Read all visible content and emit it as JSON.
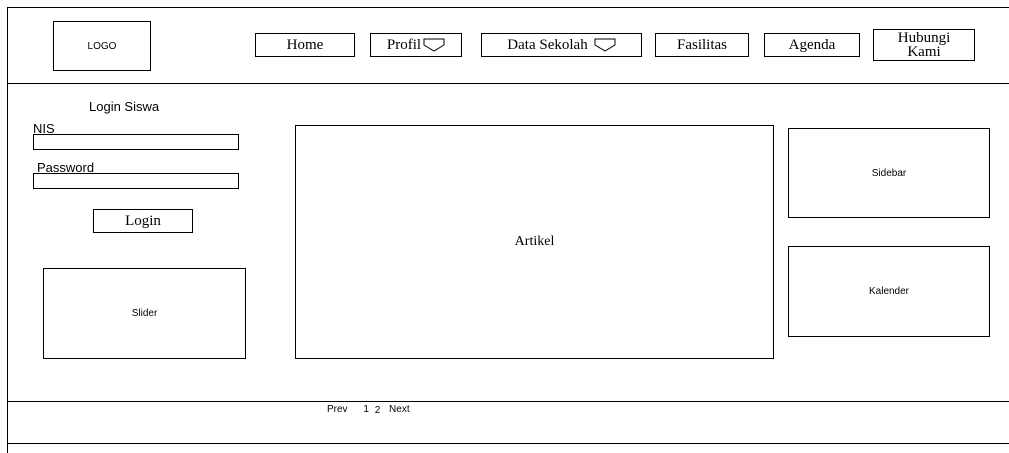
{
  "header": {
    "logo": "LOGO",
    "nav": [
      {
        "label": "Home",
        "dropdown": false
      },
      {
        "label": "Profil",
        "dropdown": true
      },
      {
        "label": "Data Sekolah",
        "dropdown": true
      },
      {
        "label": "Fasilitas",
        "dropdown": false
      },
      {
        "label": "Agenda",
        "dropdown": false
      },
      {
        "label_line1": "Hubungi",
        "label_line2": "Kami",
        "dropdown": false
      }
    ]
  },
  "login": {
    "title": "Login Siswa",
    "nis_label": "NIS",
    "nis_value": "",
    "password_label": "Password",
    "password_value": "",
    "button": "Login"
  },
  "slider": {
    "label": "Slider"
  },
  "article": {
    "label": "Artikel"
  },
  "pagination": {
    "prev": "Prev",
    "pages": [
      "1",
      "2"
    ],
    "next": "Next"
  },
  "sidebar": {
    "label": "Sidebar"
  },
  "calendar": {
    "label": "Kalender"
  }
}
